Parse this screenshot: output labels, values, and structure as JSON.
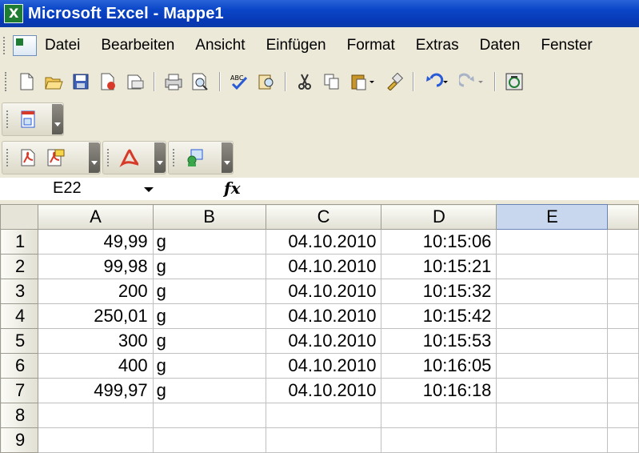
{
  "window": {
    "title": "Microsoft Excel - Mappe1"
  },
  "menu": [
    "Datei",
    "Bearbeiten",
    "Ansicht",
    "Einfügen",
    "Format",
    "Extras",
    "Daten",
    "Fenster"
  ],
  "toolbar": {
    "icons": [
      "new-icon",
      "open-icon",
      "save-icon",
      "permission-icon",
      "email-icon",
      "print-icon",
      "print-preview-icon",
      "spelling-icon",
      "research-icon",
      "cut-icon",
      "copy-icon",
      "paste-icon",
      "format-painter-icon",
      "undo-icon",
      "redo-icon",
      "office-icon"
    ]
  },
  "formula_bar": {
    "name_box": "E22",
    "fx": "fx",
    "content": ""
  },
  "columns": [
    "A",
    "B",
    "C",
    "D",
    "E"
  ],
  "rows": [
    {
      "n": "1",
      "a": "49,99",
      "b": "g",
      "c": "04.10.2010",
      "d": "10:15:06",
      "e": ""
    },
    {
      "n": "2",
      "a": "99,98",
      "b": "g",
      "c": "04.10.2010",
      "d": "10:15:21",
      "e": ""
    },
    {
      "n": "3",
      "a": "200",
      "b": "g",
      "c": "04.10.2010",
      "d": "10:15:32",
      "e": ""
    },
    {
      "n": "4",
      "a": "250,01",
      "b": "g",
      "c": "04.10.2010",
      "d": "10:15:42",
      "e": ""
    },
    {
      "n": "5",
      "a": "300",
      "b": "g",
      "c": "04.10.2010",
      "d": "10:15:53",
      "e": ""
    },
    {
      "n": "6",
      "a": "400",
      "b": "g",
      "c": "04.10.2010",
      "d": "10:16:05",
      "e": ""
    },
    {
      "n": "7",
      "a": "499,97",
      "b": "g",
      "c": "04.10.2010",
      "d": "10:16:18",
      "e": ""
    },
    {
      "n": "8",
      "a": "",
      "b": "",
      "c": "",
      "d": "",
      "e": ""
    },
    {
      "n": "9",
      "a": "",
      "b": "",
      "c": "",
      "d": "",
      "e": ""
    }
  ],
  "colors": {
    "titlebar": "#0a46c8",
    "active_column": "#c8d7ee"
  }
}
